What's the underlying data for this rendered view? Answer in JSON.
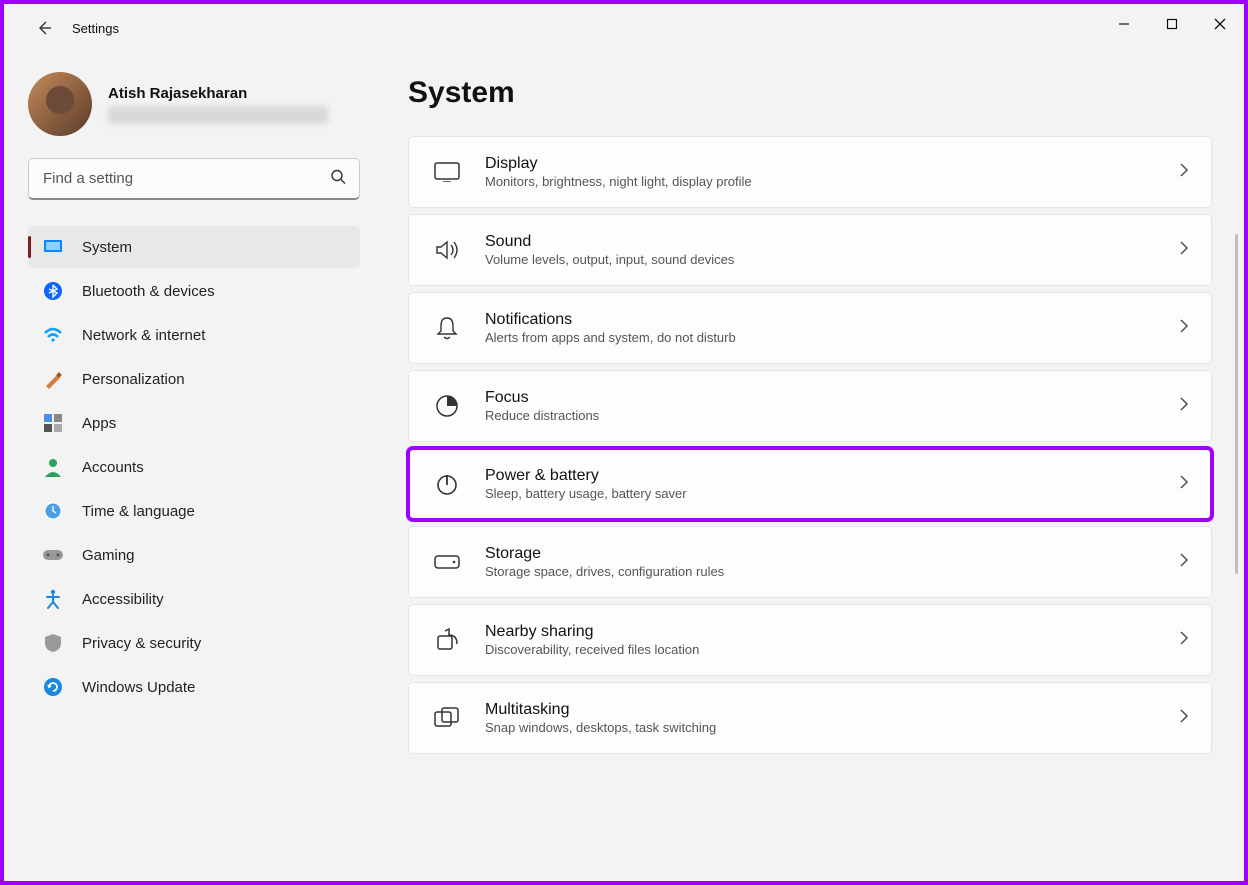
{
  "app": {
    "title": "Settings"
  },
  "profile": {
    "name": "Atish Rajasekharan"
  },
  "search": {
    "placeholder": "Find a setting"
  },
  "sidebar": {
    "items": [
      {
        "id": "system",
        "label": "System",
        "active": true
      },
      {
        "id": "bluetooth",
        "label": "Bluetooth & devices"
      },
      {
        "id": "network",
        "label": "Network & internet"
      },
      {
        "id": "personalization",
        "label": "Personalization"
      },
      {
        "id": "apps",
        "label": "Apps"
      },
      {
        "id": "accounts",
        "label": "Accounts"
      },
      {
        "id": "time",
        "label": "Time & language"
      },
      {
        "id": "gaming",
        "label": "Gaming"
      },
      {
        "id": "accessibility",
        "label": "Accessibility"
      },
      {
        "id": "privacy",
        "label": "Privacy & security"
      },
      {
        "id": "update",
        "label": "Windows Update"
      }
    ]
  },
  "page": {
    "title": "System",
    "cards": [
      {
        "id": "display",
        "title": "Display",
        "desc": "Monitors, brightness, night light, display profile"
      },
      {
        "id": "sound",
        "title": "Sound",
        "desc": "Volume levels, output, input, sound devices"
      },
      {
        "id": "notifications",
        "title": "Notifications",
        "desc": "Alerts from apps and system, do not disturb"
      },
      {
        "id": "focus",
        "title": "Focus",
        "desc": "Reduce distractions"
      },
      {
        "id": "power",
        "title": "Power & battery",
        "desc": "Sleep, battery usage, battery saver",
        "highlight": true
      },
      {
        "id": "storage",
        "title": "Storage",
        "desc": "Storage space, drives, configuration rules"
      },
      {
        "id": "nearby",
        "title": "Nearby sharing",
        "desc": "Discoverability, received files location"
      },
      {
        "id": "multitasking",
        "title": "Multitasking",
        "desc": "Snap windows, desktops, task switching"
      }
    ]
  }
}
